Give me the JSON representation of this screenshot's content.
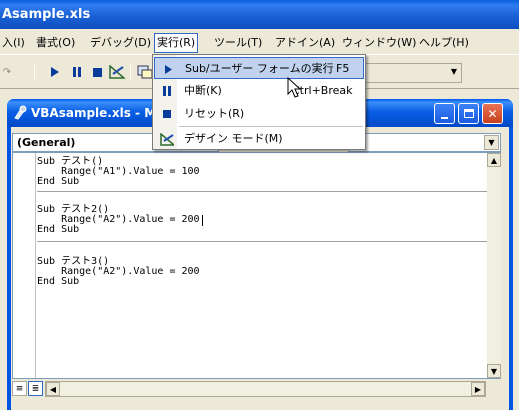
{
  "app_title": "Asample.xls",
  "menu": {
    "items": [
      "入(I)",
      "書式(O)",
      "デバッグ(D)",
      "実行(R)",
      "ツール(T)",
      "アドイン(A)",
      "ウィンドウ(W)",
      "ヘルプ(H)"
    ],
    "open_index": 3
  },
  "dropdown": {
    "items": [
      {
        "label": "Sub/ユーザー フォームの実行",
        "shortcut": "F5",
        "icon": "run-icon",
        "highlighted": true
      },
      {
        "label": "中断(K)",
        "shortcut": "Ctrl+Break",
        "icon": "break-icon",
        "highlighted": false
      },
      {
        "label": "リセット(R)",
        "shortcut": "",
        "icon": "reset-icon",
        "highlighted": false
      },
      {
        "label": "デザイン モード(M)",
        "shortcut": "",
        "icon": "design-mode-icon",
        "highlighted": false
      }
    ]
  },
  "code_window": {
    "title": "VBAsample.xls - M",
    "object_combo": "(General)",
    "procedure_combo": "",
    "code_blocks": [
      [
        "Sub テスト()",
        "    Range(\"A1\").Value = 100",
        "End Sub"
      ],
      [
        "Sub テスト2()",
        "    Range(\"A2\").Value = 200",
        "End Sub"
      ],
      [
        "Sub テスト3()",
        "    Range(\"A2\").Value = 200",
        "End Sub"
      ]
    ]
  },
  "colors": {
    "xp_blue": "#0054E3",
    "menu_highlight": "#C1D2EE",
    "menu_border": "#316AC5",
    "close_red": "#C7401E"
  }
}
